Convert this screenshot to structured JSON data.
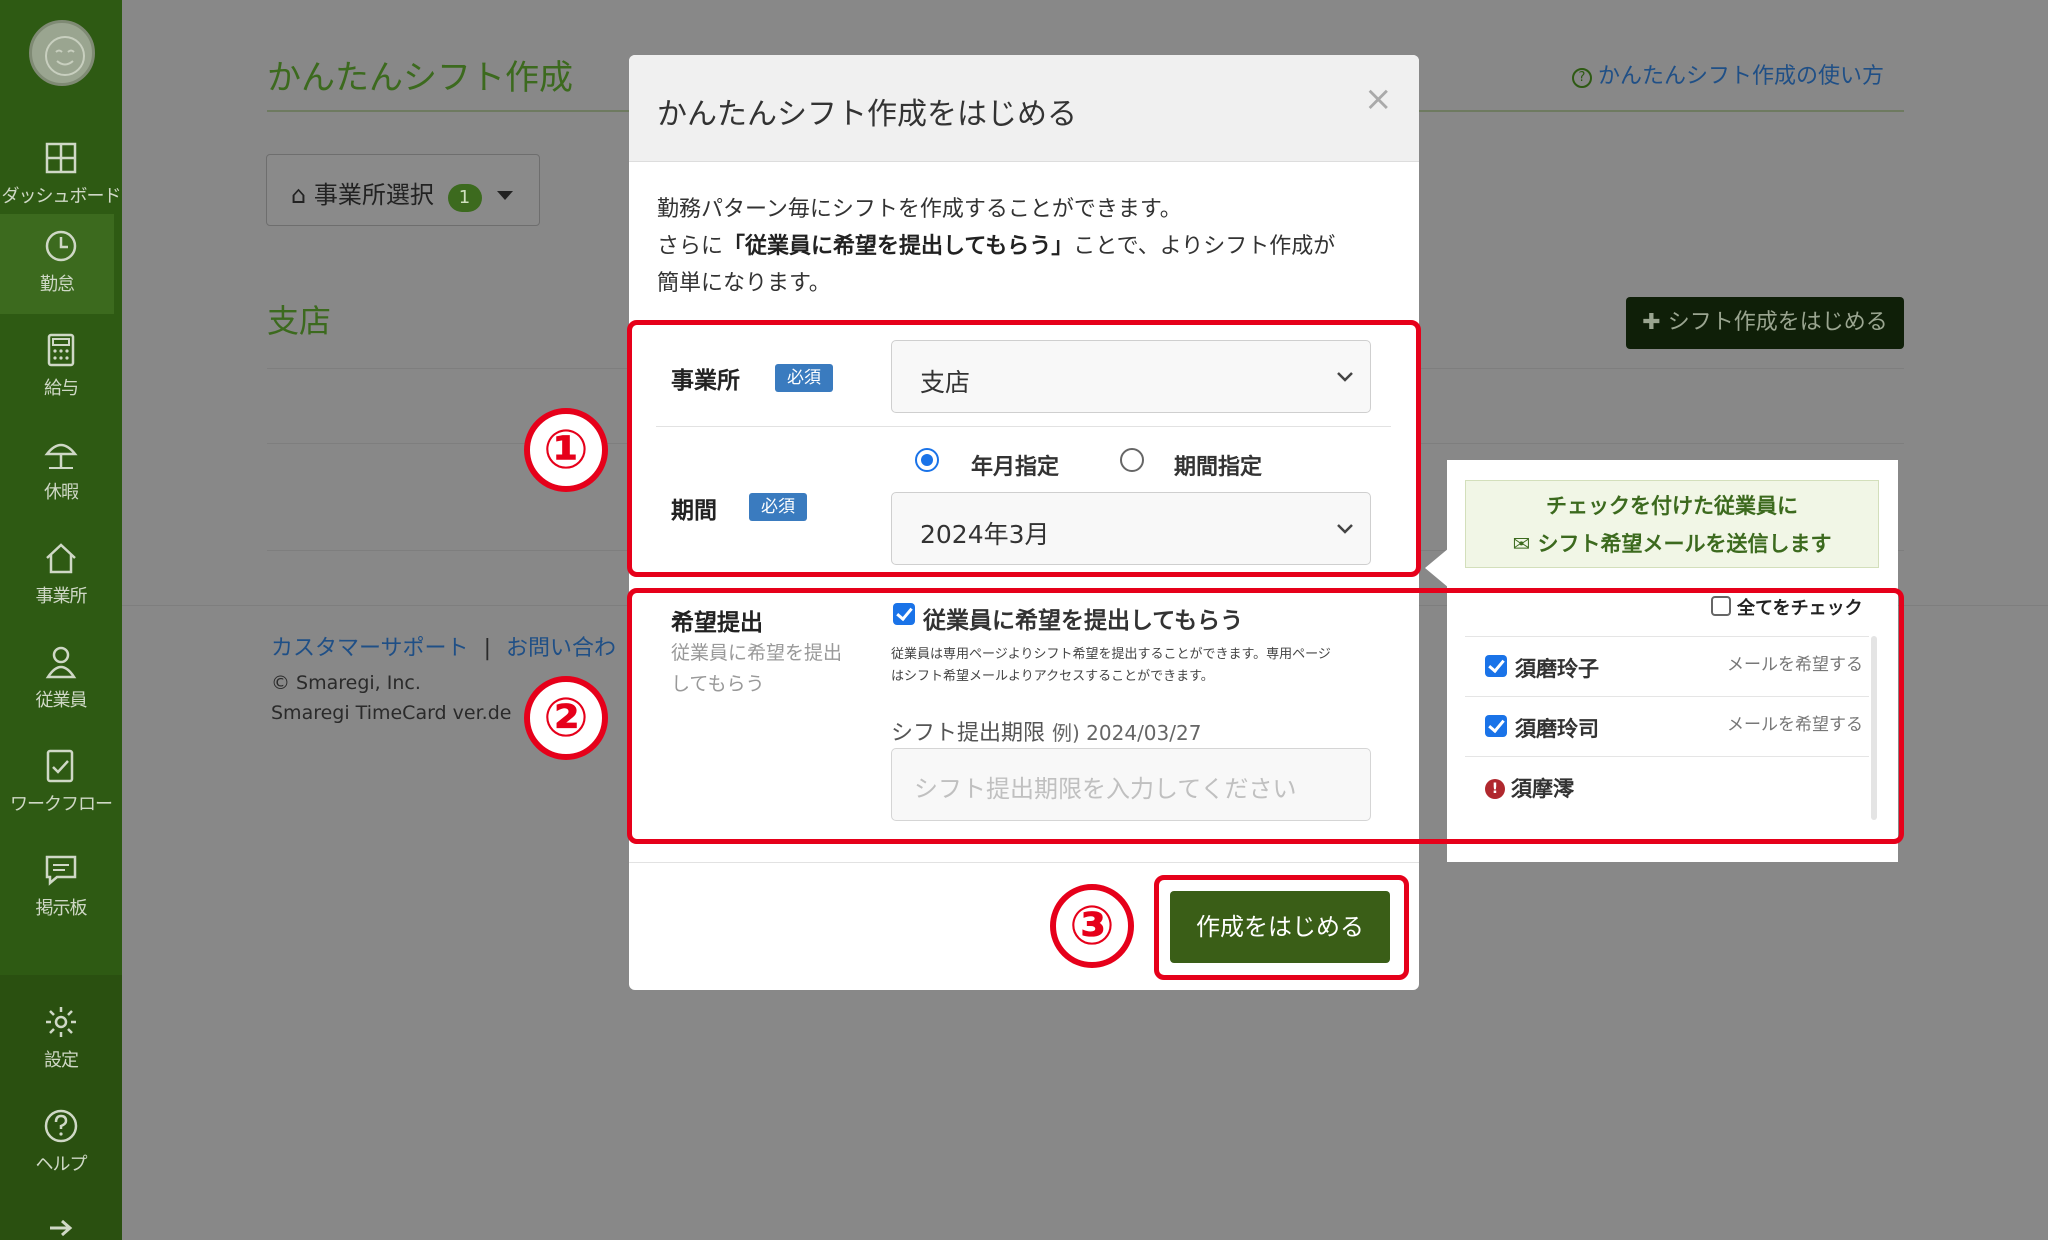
{
  "sidebar": {
    "items": [
      {
        "label": "ダッシュボード",
        "icon": "dashboard-icon"
      },
      {
        "label": "勤怠",
        "icon": "clock-icon"
      },
      {
        "label": "給与",
        "icon": "calculator-icon"
      },
      {
        "label": "休暇",
        "icon": "umbrella-icon"
      },
      {
        "label": "事業所",
        "icon": "home-icon"
      },
      {
        "label": "従業員",
        "icon": "person-icon"
      },
      {
        "label": "ワークフロー",
        "icon": "checklist-icon"
      },
      {
        "label": "掲示板",
        "icon": "message-icon"
      },
      {
        "label": "設定",
        "icon": "gear-icon"
      },
      {
        "label": "ヘルプ",
        "icon": "help-icon"
      }
    ]
  },
  "page": {
    "title": "かんたんシフト作成",
    "help_link": "かんたんシフト作成の使い方",
    "office_select_label": "事業所選択",
    "office_select_count": "1",
    "branch_title": "支店",
    "start_button": "シフト作成をはじめる",
    "footer_link_support": "カスタマーサポート",
    "footer_link_separator": "|",
    "footer_link_contact": "お問い合わ",
    "copyright": "© Smaregi, Inc.",
    "version": "Smaregi TimeCard ver.de"
  },
  "modal": {
    "title": "かんたんシフト作成をはじめる",
    "close": "×",
    "intro_line1": "勤務パターン毎にシフトを作成することができます。",
    "intro_line2_pre": "さらに",
    "intro_line2_bold": "「従業員に希望を提出してもらう」",
    "intro_line2_post": "ことで、よりシフト作成が",
    "intro_line3": "簡単になります。",
    "office_label": "事業所",
    "required_badge": "必須",
    "office_value": "支店",
    "period_label": "期間",
    "radio_month": "年月指定",
    "radio_range": "期間指定",
    "period_value": "2024年3月",
    "request_label": "希望提出",
    "request_help_line1": "従業員に希望を提出",
    "request_help_line2": "してもらう",
    "request_checkbox": "従業員に希望を提出してもらう",
    "request_note_line1": "従業員は専用ページよりシフト希望を提出することができます。専用ページ",
    "request_note_line2": "はシフト希望メールよりアクセスすることができます。",
    "deadline_label": "シフト提出期限",
    "deadline_example": "例) 2024/03/27",
    "deadline_placeholder": "シフト提出期限を入力してください",
    "submit": "作成をはじめる"
  },
  "panel": {
    "notice_line1": "チェックを付けた従業員に",
    "notice_line2": "シフト希望メールを送信します",
    "check_all": "全てをチェック",
    "employees": [
      {
        "name": "須磨玲子",
        "status": "メールを希望する",
        "checked": true
      },
      {
        "name": "須磨玲司",
        "status": "メールを希望する",
        "checked": true
      },
      {
        "name": "須摩澪",
        "status": "",
        "warning": true
      }
    ]
  },
  "annotations": {
    "step1": "①",
    "step2": "②",
    "step3": "③"
  },
  "colors": {
    "sidebar": "#2e5a13",
    "accent_green": "#3a5e17",
    "annotation_red": "#e6001a",
    "required_blue": "#3a7bbf"
  }
}
